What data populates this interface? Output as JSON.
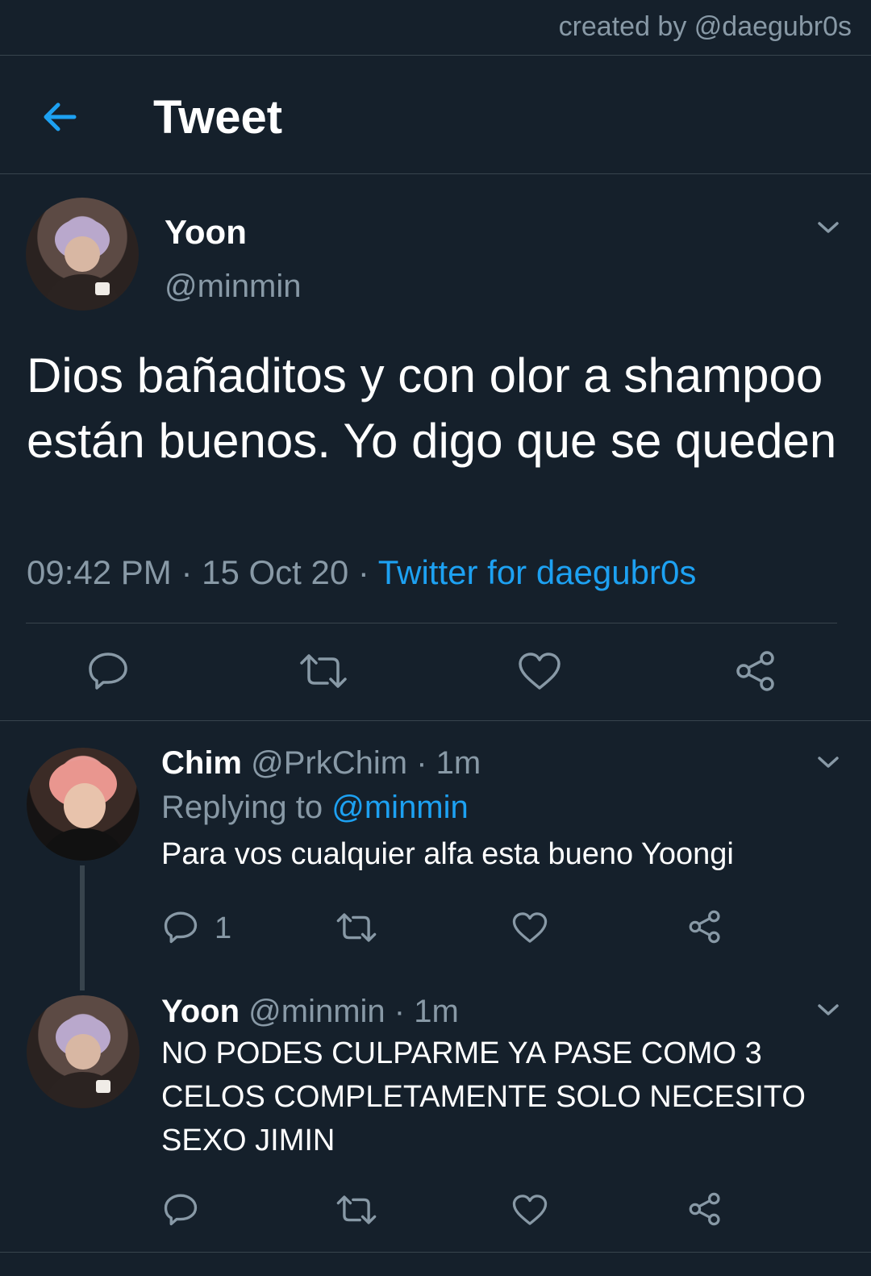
{
  "credit": "created by @daegubr0s",
  "header": {
    "title": "Tweet",
    "back_icon": "arrow-left-icon"
  },
  "main_tweet": {
    "name": "Yoon",
    "handle": "@minmin",
    "text": "Dios bañaditos y con olor a shampoo están buenos. Yo digo que se queden",
    "time": "09:42 PM",
    "date": "15 Oct 20",
    "source": "Twitter for daegubr0s",
    "sep": " · "
  },
  "replies": [
    {
      "name": "Chim",
      "handle": "@PrkChim",
      "age": "1m",
      "replying_label": "Replying to",
      "replying_to": "@minmin",
      "text": "Para vos cualquier alfa esta bueno Yoongi",
      "reply_count": "1"
    },
    {
      "name": "Yoon",
      "handle": "@minmin",
      "age": "1m",
      "text": "NO PODES CULPARME YA PASE COMO 3 CELOS COMPLETAMENTE SOLO NECESITO SEXO JIMIN"
    }
  ],
  "colors": {
    "background": "#15202b",
    "accent": "#1da1f2",
    "muted": "#8899a6",
    "divider": "#38444d"
  }
}
